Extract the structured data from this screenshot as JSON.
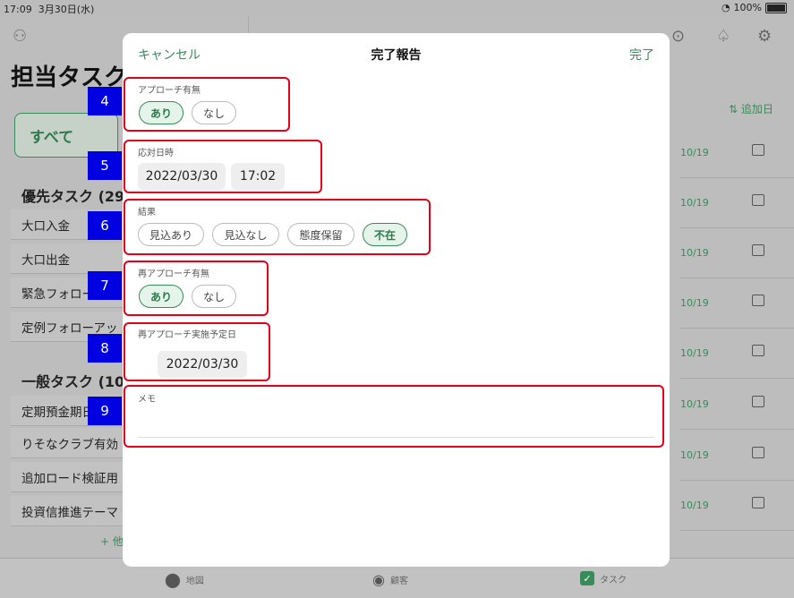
{
  "status_bar": {
    "time": "17:09",
    "date": "3月30日(水)",
    "battery": "100%"
  },
  "background": {
    "title": "担当タスク",
    "filter_label": "すべて",
    "priority_section": "優先タスク (29",
    "priority_items": [
      "大口入金",
      "大口出金",
      "緊急フォロー",
      "定例フォローアッ"
    ],
    "general_section": "一般タスク (10",
    "general_items": [
      "定期預金期日",
      "りそなクラブ有効",
      "追加ロード検証用",
      "投資信推進テーマ"
    ],
    "more_link": "+ 他",
    "sort_label": "⇅ 追加日",
    "due_dates": [
      "10/19",
      "10/19",
      "10/19",
      "10/19",
      "10/19",
      "10/19",
      "10/19",
      "10/19"
    ]
  },
  "tabbar": {
    "tabs": [
      {
        "label": "地図",
        "icon": "map-pin-icon"
      },
      {
        "label": "顧客",
        "icon": "person-icon"
      },
      {
        "label": "タスク",
        "icon": "check-icon"
      }
    ]
  },
  "modal": {
    "cancel_label": "キャンセル",
    "title": "完了報告",
    "done_label": "完了",
    "approach": {
      "label": "アプローチ有無",
      "options": [
        "あり",
        "なし"
      ],
      "selected": "あり"
    },
    "response_datetime": {
      "label": "応対日時",
      "date": "2022/03/30",
      "time": "17:02"
    },
    "result": {
      "label": "結果",
      "options": [
        "見込あり",
        "見込なし",
        "態度保留",
        "不在"
      ],
      "selected": "不在"
    },
    "reapproach": {
      "label": "再アプローチ有無",
      "options": [
        "あり",
        "なし"
      ],
      "selected": "あり"
    },
    "reapproach_date": {
      "label": "再アプローチ実施予定日",
      "date": "2022/03/30"
    },
    "memo": {
      "label": "メモ",
      "value": ""
    }
  },
  "annotations": [
    "4",
    "5",
    "6",
    "7",
    "8",
    "9"
  ],
  "colors": {
    "accent": "#3a8a5a",
    "highlight": "#e0001a",
    "marker": "#0000e0"
  }
}
